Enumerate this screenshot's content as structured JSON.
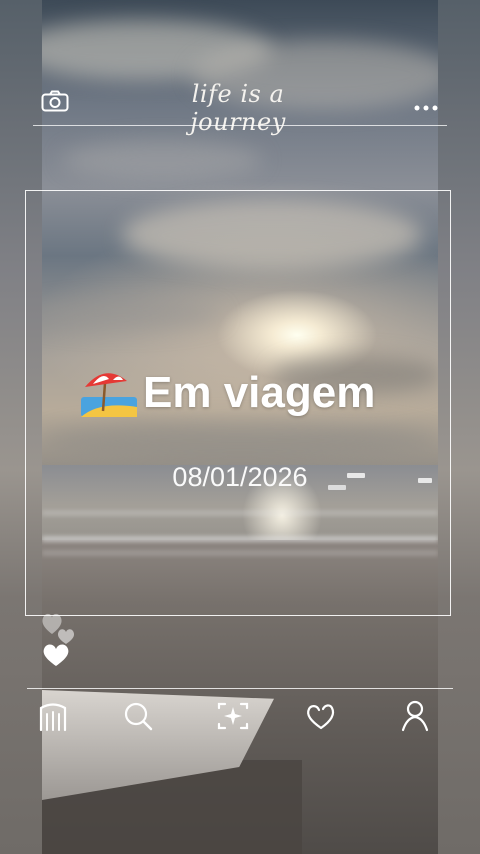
{
  "header": {
    "brand_text": "life is a journey",
    "left_icon": "camera-icon",
    "right_icon": "more-horizontal-icon"
  },
  "status": {
    "emoji_icon": "beach-umbrella-emoji",
    "text": "Em viagem",
    "date": "08/01/2026"
  },
  "reactions": {
    "icon": "hearts-icon"
  },
  "nav": {
    "items": [
      {
        "icon": "home-icon"
      },
      {
        "icon": "search-icon"
      },
      {
        "icon": "sparkle-frame-icon"
      },
      {
        "icon": "heart-outline-icon"
      },
      {
        "icon": "profile-icon"
      }
    ]
  },
  "colors": {
    "foreground": "#ffffff"
  }
}
